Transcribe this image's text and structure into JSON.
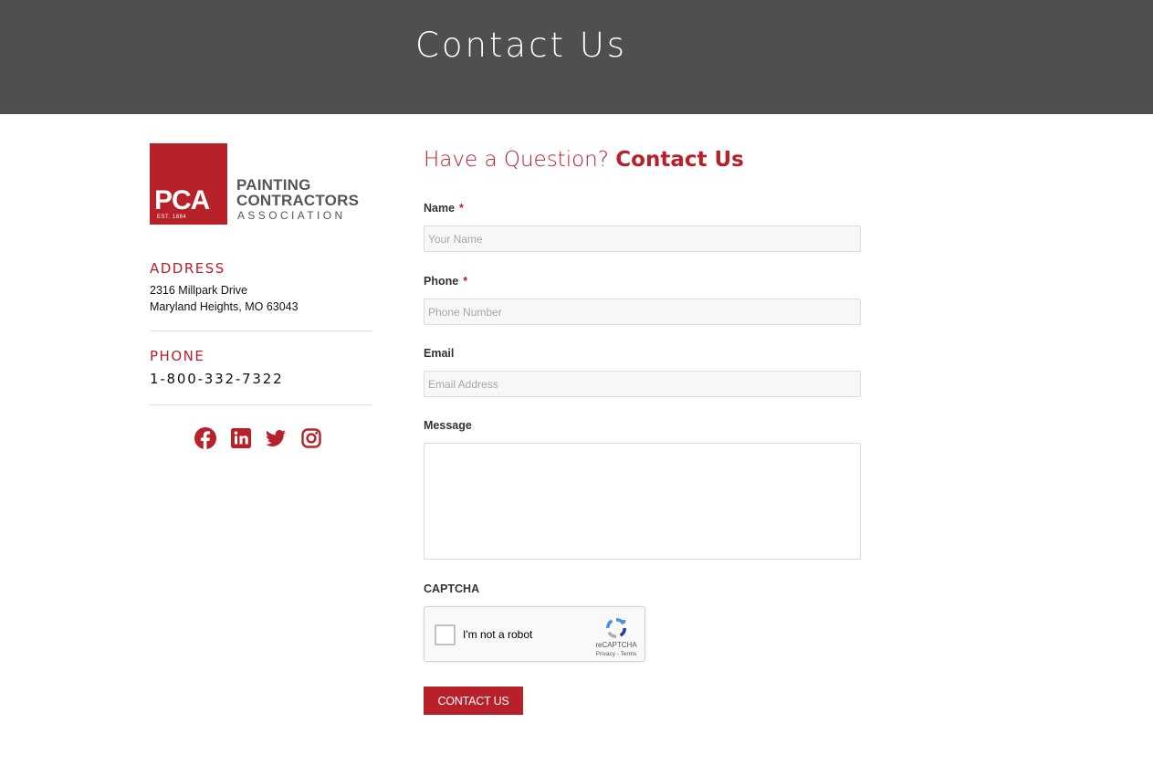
{
  "hero": {
    "title": "Contact Us"
  },
  "logo": {
    "abbr": "PCA",
    "est": "EST. 1884",
    "line1": "PAINTING",
    "line2": "CONTRACTORS",
    "line3": "ASSOCIATION"
  },
  "address": {
    "label": "ADDRESS",
    "line1": "2316 Millpark Drive",
    "line2": "Maryland Heights, MO 63043"
  },
  "phone": {
    "label": "PHONE",
    "number": "1-800-332-7322"
  },
  "social": {
    "icons": [
      "facebook-icon",
      "linkedin-icon",
      "twitter-icon",
      "instagram-icon"
    ],
    "color": "#b8202a"
  },
  "form": {
    "title_light": "Have a Question?",
    "title_bold": "Contact Us",
    "required_mark": "*",
    "name_label": "Name",
    "name_placeholder": "Your Name",
    "name_value": "",
    "phone_label": "Phone",
    "phone_placeholder": "Phone Number",
    "phone_value": "",
    "email_label": "Email",
    "email_placeholder": "Email Address",
    "email_value": "",
    "message_label": "Message",
    "message_value": "",
    "captcha_label": "CAPTCHA",
    "captcha_text": "I'm not a robot",
    "captcha_brand": "reCAPTCHA",
    "captcha_terms": "Privacy - Terms",
    "submit_label": "CONTACT US"
  },
  "colors": {
    "accent": "#b8202a",
    "hero_bg": "#4f4f4f"
  }
}
